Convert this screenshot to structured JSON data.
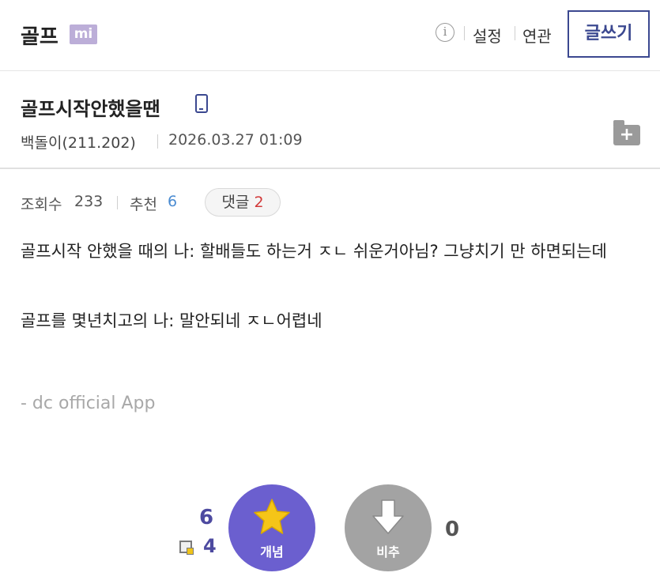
{
  "header": {
    "gallery_name": "골프",
    "badge": "mi",
    "info_icon": "i",
    "settings_label": "설정",
    "related_label": "연관",
    "write_label": "글쓰기"
  },
  "post": {
    "title": "골프시작안했을땐",
    "author": "백돌이(211.202)",
    "date": "2026.03.27 01:09",
    "folder_plus": "+",
    "stats": {
      "views_label": "조회수",
      "views": "233",
      "recommend_label": "추천",
      "recommend": "6",
      "comments_label": "댓글",
      "comments": "2"
    },
    "body": [
      "골프시작 안했을 때의 나: 할배들도 하는거 ㅈㄴ 쉬운거아님? 그냥치기 만 하면되는데",
      "골프를 몇년치고의 나: 말안되네 ㅈㄴ어렵네"
    ],
    "signature": "- dc official App"
  },
  "vote": {
    "up_count": "6",
    "fixed_count": "4",
    "up_label": "개념",
    "down_label": "비추",
    "down_count": "0"
  },
  "colors": {
    "accent": "#3b4890",
    "up_button": "#6b5fcf",
    "down_button": "#a3a3a3",
    "recommend_blue": "#4a8bd1",
    "comment_red": "#d23a3a",
    "badge": "#bcaed8"
  }
}
